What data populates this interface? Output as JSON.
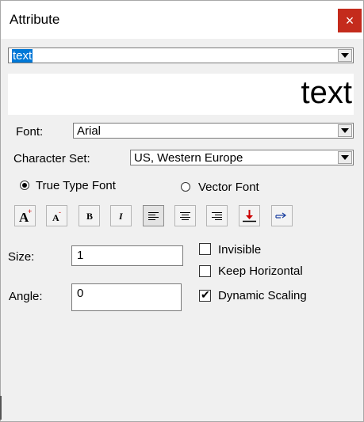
{
  "window": {
    "title": "Attribute",
    "close_label": "×"
  },
  "text_select": {
    "value": "text"
  },
  "preview": {
    "text": "text"
  },
  "font": {
    "label": "Font:",
    "value": "Arial"
  },
  "charset": {
    "label": "Character Set:",
    "value": "US, Western Europe"
  },
  "font_type": {
    "options": [
      {
        "label": "True Type Font",
        "checked": true
      },
      {
        "label": "Vector Font",
        "checked": false
      }
    ]
  },
  "toolbar": {
    "buttons": [
      {
        "icon": "font-larger-icon"
      },
      {
        "icon": "font-smaller-icon"
      },
      {
        "icon": "bold-icon",
        "glyph": "B"
      },
      {
        "icon": "italic-icon",
        "glyph": "I"
      },
      {
        "icon": "align-left-icon"
      },
      {
        "icon": "align-center-icon"
      },
      {
        "icon": "align-right-icon"
      },
      {
        "icon": "baseline-icon"
      },
      {
        "icon": "pointer-icon"
      }
    ]
  },
  "size": {
    "label": "Size:",
    "value": "1"
  },
  "angle": {
    "label": "Angle:",
    "value": "0"
  },
  "options": {
    "invisible": {
      "label": "Invisible",
      "checked": false,
      "mark": ""
    },
    "keep_horizontal": {
      "label": "Keep Horizontal",
      "checked": false,
      "mark": ""
    },
    "dynamic_scaling": {
      "label": "Dynamic Scaling",
      "checked": true,
      "mark": "✔"
    }
  },
  "colors": {
    "close_bg": "#c42b1c",
    "selection": "#0078d7",
    "baseline_arrow": "#cc0000",
    "pointer": "#1a3fa0"
  }
}
